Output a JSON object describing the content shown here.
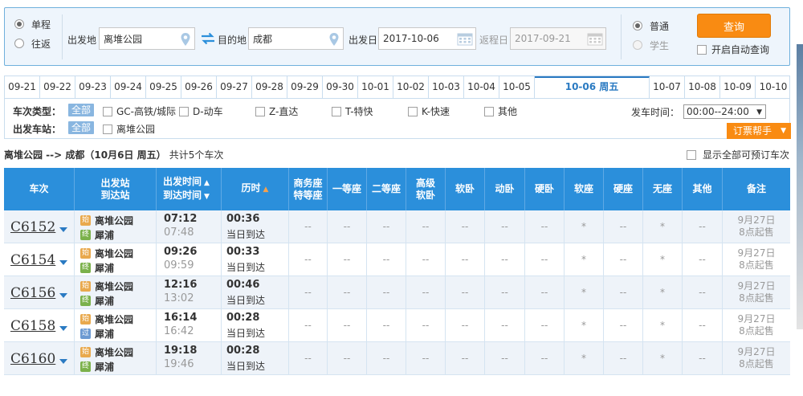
{
  "search": {
    "trip_types": [
      {
        "label": "单程",
        "selected": true
      },
      {
        "label": "往返",
        "selected": false
      }
    ],
    "from_label": "出发地",
    "from_value": "离堆公园",
    "to_label": "目的地",
    "to_value": "成都",
    "depart_label": "出发日",
    "depart_value": "2017-10-06",
    "return_label": "返程日",
    "return_value": "2017-09-21",
    "passenger_types": [
      {
        "label": "普通",
        "selected": true
      },
      {
        "label": "学生",
        "selected": false
      }
    ],
    "query_label": "查询",
    "auto_query_label": "开启自动查询"
  },
  "date_tabs": [
    "09-21",
    "09-22",
    "09-23",
    "09-24",
    "09-25",
    "09-26",
    "09-27",
    "09-28",
    "09-29",
    "09-30",
    "10-01",
    "10-02",
    "10-03",
    "10-04",
    "10-05",
    "10-06 周五",
    "10-07",
    "10-08",
    "10-09",
    "10-10"
  ],
  "active_date_index": 15,
  "filter": {
    "train_type_label": "车次类型：",
    "all_label": "全部",
    "train_types": [
      "GC-高铁/城际",
      "D-动车",
      "Z-直达",
      "T-特快",
      "K-快速",
      "其他"
    ],
    "station_label": "出发车站：",
    "stations": [
      "离堆公园"
    ],
    "depart_time_label": "发车时间：",
    "depart_time_value": "00:00--24:00",
    "help_label": "订票帮手"
  },
  "summary": {
    "route": "离堆公园 --> 成都（10月6日  周五）",
    "count": "共计5个车次",
    "show_all_label": "显示全部可预订车次"
  },
  "table": {
    "headers": {
      "train": "车次",
      "station_top": "出发站",
      "station_bottom": "到达站",
      "time_top": "出发时间",
      "time_bottom": "到达时间",
      "duration": "历时",
      "business_top": "商务座",
      "business_bottom": "特等座",
      "first": "一等座",
      "second": "二等座",
      "soft_sleeper_top": "高级",
      "soft_sleeper_bottom": "软卧",
      "soft_berth": "软卧",
      "motor_berth": "动卧",
      "hard_berth": "硬卧",
      "soft_seat": "软座",
      "hard_seat": "硬座",
      "no_seat": "无座",
      "other": "其他",
      "note": "备注"
    },
    "start_badge": "始",
    "end_badge": "终",
    "pass_badge": "过",
    "rows": [
      {
        "train": "C6152",
        "from": "离堆公园",
        "to": "犀浦",
        "to_badge": "终",
        "dep": "07:12",
        "arr": "07:48",
        "duration": "00:36",
        "arrive_day": "当日到达",
        "seats": [
          "--",
          "--",
          "--",
          "--",
          "--",
          "--",
          "--",
          "*",
          "--",
          "*",
          "--"
        ],
        "note_top": "9月27日",
        "note_bottom": "8点起售"
      },
      {
        "train": "C6154",
        "from": "离堆公园",
        "to": "犀浦",
        "to_badge": "终",
        "dep": "09:26",
        "arr": "09:59",
        "duration": "00:33",
        "arrive_day": "当日到达",
        "seats": [
          "--",
          "--",
          "--",
          "--",
          "--",
          "--",
          "--",
          "*",
          "--",
          "*",
          "--"
        ],
        "note_top": "9月27日",
        "note_bottom": "8点起售"
      },
      {
        "train": "C6156",
        "from": "离堆公园",
        "to": "犀浦",
        "to_badge": "终",
        "dep": "12:16",
        "arr": "13:02",
        "duration": "00:46",
        "arrive_day": "当日到达",
        "seats": [
          "--",
          "--",
          "--",
          "--",
          "--",
          "--",
          "--",
          "*",
          "--",
          "*",
          "--"
        ],
        "note_top": "9月27日",
        "note_bottom": "8点起售"
      },
      {
        "train": "C6158",
        "from": "离堆公园",
        "to": "犀浦",
        "to_badge": "过",
        "dep": "16:14",
        "arr": "16:42",
        "duration": "00:28",
        "arrive_day": "当日到达",
        "seats": [
          "--",
          "--",
          "--",
          "--",
          "--",
          "--",
          "--",
          "*",
          "--",
          "*",
          "--"
        ],
        "note_top": "9月27日",
        "note_bottom": "8点起售"
      },
      {
        "train": "C6160",
        "from": "离堆公园",
        "to": "犀浦",
        "to_badge": "终",
        "dep": "19:18",
        "arr": "19:46",
        "duration": "00:28",
        "arrive_day": "当日到达",
        "seats": [
          "--",
          "--",
          "--",
          "--",
          "--",
          "--",
          "--",
          "*",
          "--",
          "*",
          "--"
        ],
        "note_top": "9月27日",
        "note_bottom": "8点起售"
      }
    ]
  },
  "colors": {
    "header_blue": "#2b8fdb",
    "accent_orange": "#f98b12",
    "link_blue": "#2a7ac2"
  }
}
